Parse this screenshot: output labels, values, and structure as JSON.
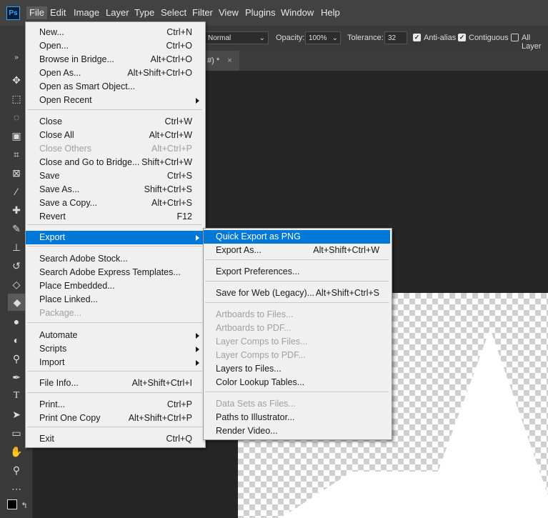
{
  "menubar": {
    "logo": "Ps",
    "items": [
      "File",
      "Edit",
      "Image",
      "Layer",
      "Type",
      "Select",
      "Filter",
      "View",
      "Plugins",
      "Window",
      "Help"
    ]
  },
  "options": {
    "mode": "Normal",
    "opacity_label": "Opacity:",
    "opacity_value": "100%",
    "tolerance_label": "Tolerance:",
    "tolerance_value": "32",
    "antialias": "Anti-alias",
    "contiguous": "Contiguous",
    "all_layers": "All Layer"
  },
  "tab": {
    "title": "#) *",
    "close": "×"
  },
  "file_menu": {
    "items": [
      {
        "label": "New...",
        "shortcut": "Ctrl+N"
      },
      {
        "label": "Open...",
        "shortcut": "Ctrl+O"
      },
      {
        "label": "Browse in Bridge...",
        "shortcut": "Alt+Ctrl+O"
      },
      {
        "label": "Open As...",
        "shortcut": "Alt+Shift+Ctrl+O"
      },
      {
        "label": "Open as Smart Object...",
        "shortcut": ""
      },
      {
        "label": "Open Recent",
        "shortcut": ""
      },
      {
        "label": "Close",
        "shortcut": "Ctrl+W"
      },
      {
        "label": "Close All",
        "shortcut": "Alt+Ctrl+W"
      },
      {
        "label": "Close Others",
        "shortcut": "Alt+Ctrl+P"
      },
      {
        "label": "Close and Go to Bridge...",
        "shortcut": "Shift+Ctrl+W"
      },
      {
        "label": "Save",
        "shortcut": "Ctrl+S"
      },
      {
        "label": "Save As...",
        "shortcut": "Shift+Ctrl+S"
      },
      {
        "label": "Save a Copy...",
        "shortcut": "Alt+Ctrl+S"
      },
      {
        "label": "Revert",
        "shortcut": "F12"
      },
      {
        "label": "Export",
        "shortcut": ""
      },
      {
        "label": "Search Adobe Stock...",
        "shortcut": ""
      },
      {
        "label": "Search Adobe Express Templates...",
        "shortcut": ""
      },
      {
        "label": "Place Embedded...",
        "shortcut": ""
      },
      {
        "label": "Place Linked...",
        "shortcut": ""
      },
      {
        "label": "Package...",
        "shortcut": ""
      },
      {
        "label": "Automate",
        "shortcut": ""
      },
      {
        "label": "Scripts",
        "shortcut": ""
      },
      {
        "label": "Import",
        "shortcut": ""
      },
      {
        "label": "File Info...",
        "shortcut": "Alt+Shift+Ctrl+I"
      },
      {
        "label": "Print...",
        "shortcut": "Ctrl+P"
      },
      {
        "label": "Print One Copy",
        "shortcut": "Alt+Shift+Ctrl+P"
      },
      {
        "label": "Exit",
        "shortcut": "Ctrl+Q"
      }
    ]
  },
  "export_menu": {
    "items": [
      {
        "label": "Quick Export as PNG",
        "shortcut": ""
      },
      {
        "label": "Export As...",
        "shortcut": "Alt+Shift+Ctrl+W"
      },
      {
        "label": "Export Preferences...",
        "shortcut": ""
      },
      {
        "label": "Save for Web (Legacy)...",
        "shortcut": "Alt+Shift+Ctrl+S"
      },
      {
        "label": "Artboards to Files...",
        "shortcut": ""
      },
      {
        "label": "Artboards to PDF...",
        "shortcut": ""
      },
      {
        "label": "Layer Comps to Files...",
        "shortcut": ""
      },
      {
        "label": "Layer Comps to PDF...",
        "shortcut": ""
      },
      {
        "label": "Layers to Files...",
        "shortcut": ""
      },
      {
        "label": "Color Lookup Tables...",
        "shortcut": ""
      },
      {
        "label": "Data Sets as Files...",
        "shortcut": ""
      },
      {
        "label": "Paths to Illustrator...",
        "shortcut": ""
      },
      {
        "label": "Render Video...",
        "shortcut": ""
      }
    ]
  },
  "colors": {
    "highlight": "#0078d7",
    "menu_bg": "#f0f0f0",
    "app_bg": "#262626"
  }
}
